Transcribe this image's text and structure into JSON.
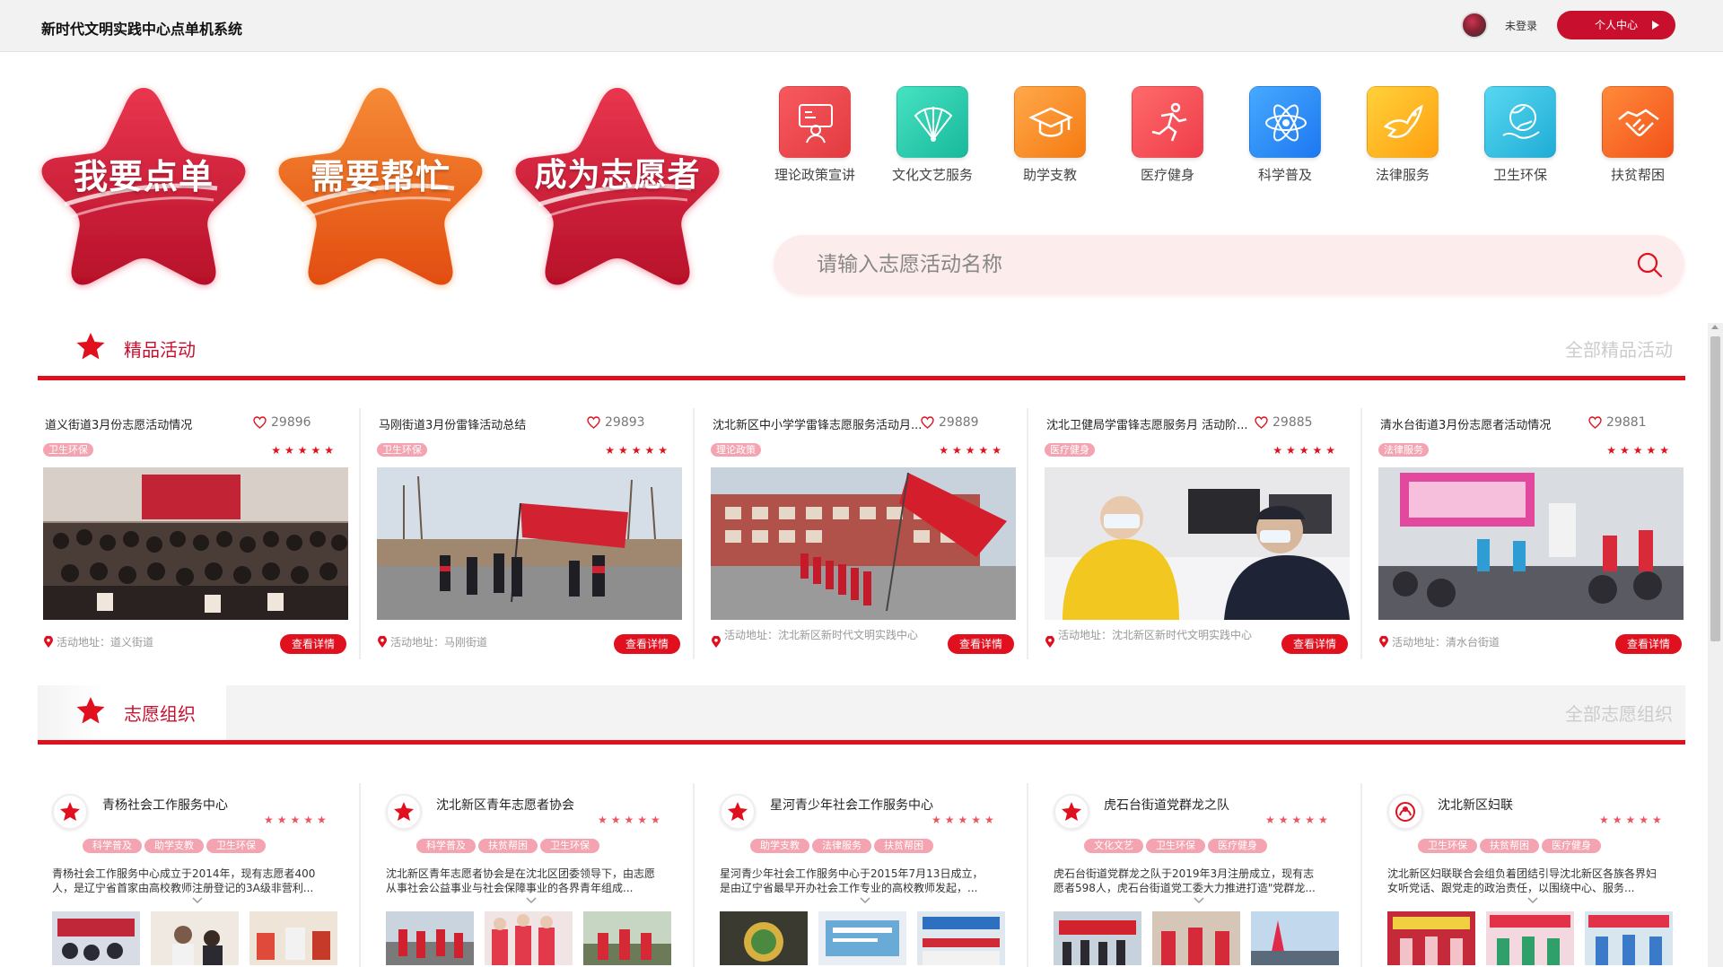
{
  "header": {
    "title": "新时代文明实践中心点单机系统",
    "login_status": "未登录",
    "user_center_label": "个人中心"
  },
  "hero": {
    "buttons": [
      {
        "label": "我要点单",
        "color_top": "#e8364e",
        "color_bottom": "#b7102a"
      },
      {
        "label": "需要帮忙",
        "color_top": "#f57a26",
        "color_bottom": "#e24d10"
      },
      {
        "label": "成为志愿者",
        "color_top": "#e8364e",
        "color_bottom": "#b7102a"
      }
    ]
  },
  "categories": [
    {
      "label": "理论政策宣讲",
      "icon": "lecture-icon",
      "color_a": "#f7595f",
      "color_b": "#e23b40"
    },
    {
      "label": "文化文艺服务",
      "icon": "fan-icon",
      "color_a": "#46e3c2",
      "color_b": "#19b89c"
    },
    {
      "label": "助学支教",
      "icon": "graduation-cap-icon",
      "color_a": "#ffa84a",
      "color_b": "#f57b12"
    },
    {
      "label": "医疗健身",
      "icon": "runner-icon",
      "color_a": "#ff6a6a",
      "color_b": "#ee3d4a"
    },
    {
      "label": "科学普及",
      "icon": "atom-icon",
      "color_a": "#47a9ff",
      "color_b": "#1d78f0"
    },
    {
      "label": "法律服务",
      "icon": "dove-icon",
      "color_a": "#ffd13a",
      "color_b": "#ff9f10"
    },
    {
      "label": "卫生环保",
      "icon": "globe-hand-icon",
      "color_a": "#57d8f0",
      "color_b": "#20acd6"
    },
    {
      "label": "扶贫帮困",
      "icon": "handshake-icon",
      "color_a": "#ff8a3a",
      "color_b": "#f2521a"
    }
  ],
  "search": {
    "placeholder": "请输入志愿活动名称"
  },
  "featured": {
    "title": "精品活动",
    "more_label": "全部精品活动",
    "address_prefix": "活动地址：",
    "detail_label": "查看详情",
    "stars": "★★★★★",
    "items": [
      {
        "title": "道义街道3月份志愿活动情况",
        "likes": "29896",
        "tag": "卫生环保",
        "address": "活动地址：道义街道"
      },
      {
        "title": "马刚街道3月份雷锋活动总结",
        "likes": "29893",
        "tag": "卫生环保",
        "address": "活动地址：马刚街道"
      },
      {
        "title": "沈北新区中小学学雷锋志愿服务活动月...",
        "likes": "29889",
        "tag": "理论政策",
        "address": "活动地址：沈北新区新时代文明实践中心"
      },
      {
        "title": "沈北卫健局学雷锋志愿服务月 活动阶...",
        "likes": "29885",
        "tag": "医疗健身",
        "address": "活动地址：沈北新区新时代文明实践中心"
      },
      {
        "title": "清水台街道3月份志愿者活动情况",
        "likes": "29881",
        "tag": "法律服务",
        "address": "活动地址：清水台街道"
      }
    ]
  },
  "orgs": {
    "title": "志愿组织",
    "more_label": "全部志愿组织",
    "stars": "★★★★★",
    "items": [
      {
        "name": "青杨社会工作服务中心",
        "tags": [
          "科学普及",
          "助学支教",
          "卫生环保"
        ],
        "desc": "青杨社会工作服务中心成立于2014年，现有志愿者400人，是辽宁省首家由高校教师注册登记的3A级非营利..."
      },
      {
        "name": "沈北新区青年志愿者协会",
        "tags": [
          "科学普及",
          "扶贫帮困",
          "卫生环保"
        ],
        "desc": "沈北新区青年志愿者协会是在沈北区团委领导下，由志愿从事社会公益事业与社会保障事业的各界青年组成..."
      },
      {
        "name": "星河青少年社会工作服务中心",
        "tags": [
          "助学支教",
          "法律服务",
          "扶贫帮困"
        ],
        "desc": "星河青少年社会工作服务中心于2015年7月13日成立，是由辽宁省最早开办社会工作专业的高校教师发起，..."
      },
      {
        "name": "虎石台街道党群龙之队",
        "tags": [
          "文化文艺",
          "卫生环保",
          "医疗健身"
        ],
        "desc": "虎石台街道党群龙之队于2019年3月注册成立，现有志愿者598人，虎石台街道党工委大力推进打造\"党群龙..."
      },
      {
        "name": "沈北新区妇联",
        "tags": [
          "卫生环保",
          "扶贫帮困",
          "医疗健身"
        ],
        "desc": "沈北新区妇联联合会组负着团结引导沈北新区各族各界妇女听党话、跟党走的政治责任，以围绕中心、服务..."
      }
    ]
  },
  "colors": {
    "brand_red": "#e0101e",
    "tag_pink": "#f4a4b0",
    "header_bg": "#f2f2f2"
  }
}
